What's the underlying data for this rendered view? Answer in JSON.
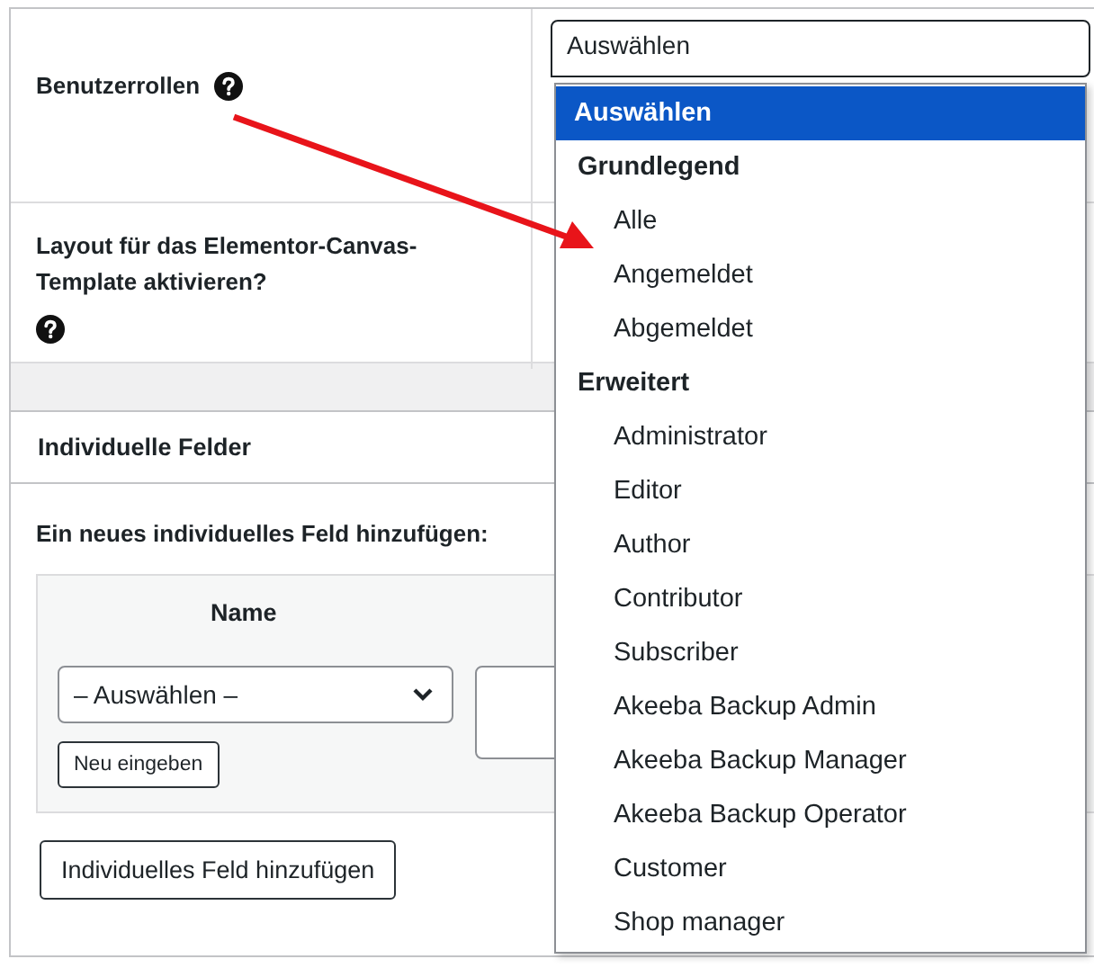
{
  "settings": [
    {
      "label": "Benutzerrollen",
      "help": true
    },
    {
      "label": "Layout für das Elementor-Canvas-Template aktivieren?",
      "help": true
    }
  ],
  "role_select": {
    "value": "Auswählen",
    "expanded": true
  },
  "dropdown": {
    "options": [
      {
        "kind": "option",
        "label": "Auswählen",
        "selected": true
      },
      {
        "kind": "group",
        "label": "Grundlegend"
      },
      {
        "kind": "option",
        "label": "Alle",
        "selected": false
      },
      {
        "kind": "option",
        "label": "Angemeldet",
        "selected": false
      },
      {
        "kind": "option",
        "label": "Abgemeldet",
        "selected": false
      },
      {
        "kind": "group",
        "label": "Erweitert"
      },
      {
        "kind": "option",
        "label": "Administrator",
        "selected": false
      },
      {
        "kind": "option",
        "label": "Editor",
        "selected": false
      },
      {
        "kind": "option",
        "label": "Author",
        "selected": false
      },
      {
        "kind": "option",
        "label": "Contributor",
        "selected": false
      },
      {
        "kind": "option",
        "label": "Subscriber",
        "selected": false
      },
      {
        "kind": "option",
        "label": "Akeeba Backup Admin",
        "selected": false
      },
      {
        "kind": "option",
        "label": "Akeeba Backup Manager",
        "selected": false
      },
      {
        "kind": "option",
        "label": "Akeeba Backup Operator",
        "selected": false
      },
      {
        "kind": "option",
        "label": "Customer",
        "selected": false
      },
      {
        "kind": "option",
        "label": "Shop manager",
        "selected": false
      }
    ]
  },
  "panel": {
    "title": "Individuelle Felder",
    "intro": "Ein neues individuelles Feld hinzufügen:",
    "table": {
      "columns": [
        "Name"
      ]
    },
    "name_select": {
      "value": "– Auswählen –"
    },
    "new_button": "Neu eingeben",
    "add_button": "Individuelles Feld hinzufügen"
  },
  "annotation": {
    "kind": "arrow"
  }
}
